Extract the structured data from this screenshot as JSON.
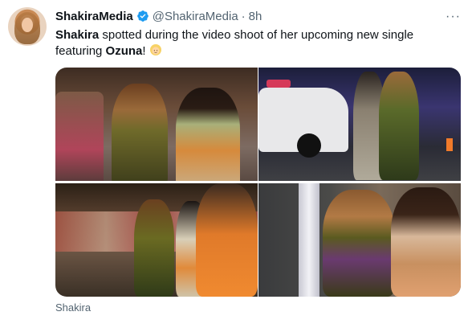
{
  "tweet": {
    "display_name": "ShakiraMedia",
    "handle": "@ShakiraMedia",
    "separator": "·",
    "time": "8h",
    "more_label": "···",
    "text_parts": {
      "name1": "Shakira",
      "middle": " spotted during the video shoot of her upcoming new single featuring ",
      "name2": "Ozuna",
      "end": "!"
    },
    "media_caption": "Shakira"
  },
  "icons": {
    "verified": "verified-badge-icon",
    "more": "more-options-icon",
    "emoji": "person-blond-hair-emoji"
  },
  "colors": {
    "text": "#0f1419",
    "secondary": "#536471",
    "verified": "#1d9bf0"
  }
}
